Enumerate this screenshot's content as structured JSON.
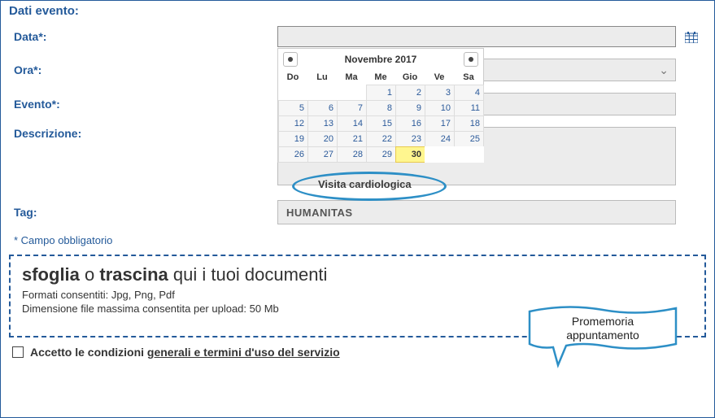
{
  "section_title": "Dati evento:",
  "labels": {
    "data": "Data*:",
    "ora": "Ora*:",
    "evento": "Evento*:",
    "descrizione": "Descrizione:",
    "tag": "Tag:"
  },
  "fields": {
    "data_value": "",
    "ora_value": "",
    "evento_value": "",
    "descrizione_value": "",
    "tag_value": "HUMANITAS"
  },
  "required_hint": "* Campo obbligatorio",
  "datepicker": {
    "title": "Novembre 2017",
    "dow": [
      "Do",
      "Lu",
      "Ma",
      "Me",
      "Gio",
      "Ve",
      "Sa"
    ],
    "weeks": [
      [
        "",
        "",
        "",
        "1",
        "2",
        "3",
        "4"
      ],
      [
        "5",
        "6",
        "7",
        "8",
        "9",
        "10",
        "11"
      ],
      [
        "12",
        "13",
        "14",
        "15",
        "16",
        "17",
        "18"
      ],
      [
        "19",
        "20",
        "21",
        "22",
        "23",
        "24",
        "25"
      ],
      [
        "26",
        "27",
        "28",
        "29",
        "30",
        "",
        ""
      ]
    ],
    "today": "30"
  },
  "annotation": {
    "evento_example": "Visita cardiologica",
    "callout_line1": "Promemoria",
    "callout_line2": "appuntamento"
  },
  "dropzone": {
    "b1": "sfoglia",
    "mid": " o ",
    "b2": "trascina",
    "rest": " qui i tuoi documenti",
    "formats": "Formati consentiti: Jpg, Png, Pdf",
    "maxsize": "Dimensione file massima consentita per upload: 50 Mb"
  },
  "terms": {
    "prefix": "Accetto le condizioni ",
    "link": "generali e termini d'uso del servizio"
  },
  "colors": {
    "brand": "#245a9a",
    "highlight": "#2d8fc6"
  }
}
